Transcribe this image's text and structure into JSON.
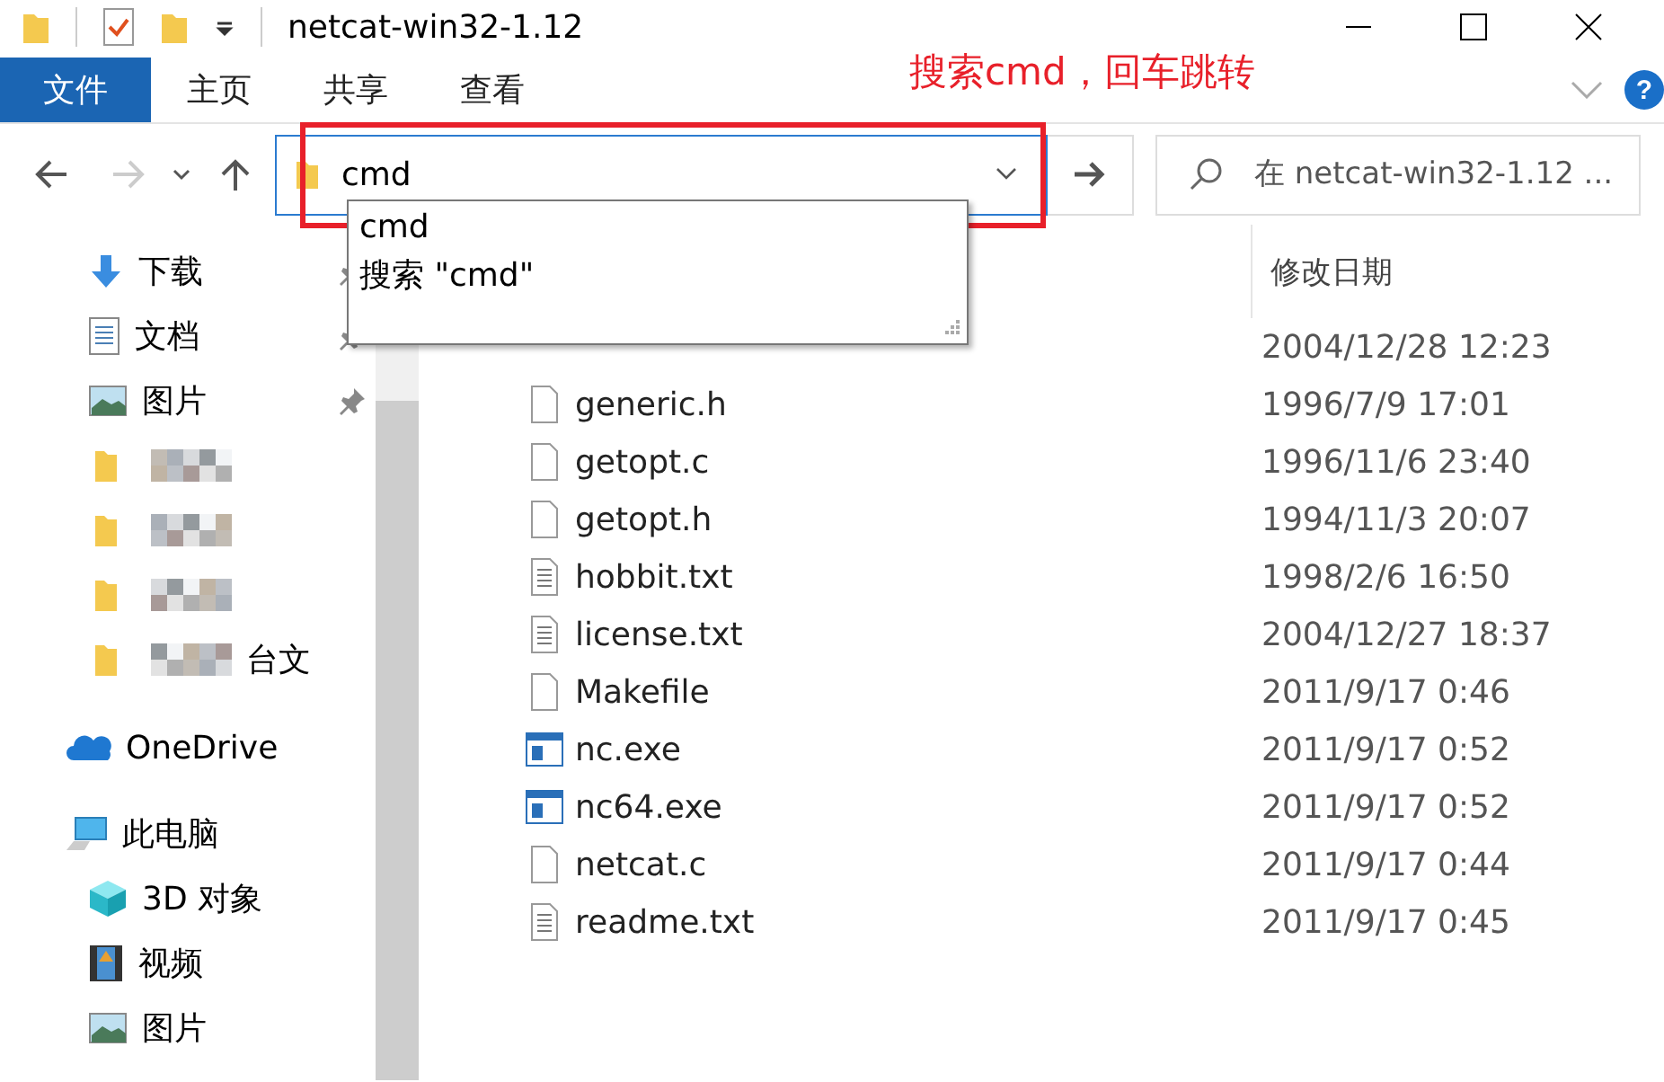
{
  "window": {
    "title": "netcat-win32-1.12"
  },
  "ribbon": {
    "tabs": [
      {
        "label": "文件",
        "selected": true
      },
      {
        "label": "主页",
        "selected": false
      },
      {
        "label": "共享",
        "selected": false
      },
      {
        "label": "查看",
        "selected": false
      }
    ],
    "help": "?"
  },
  "address": {
    "value": "cmd"
  },
  "search": {
    "placeholder": "在 netcat-win32-1.12 ..."
  },
  "autocomplete": {
    "items": [
      "cmd",
      "搜索 \"cmd\""
    ]
  },
  "annotation": {
    "text": "搜索cmd，回车跳转"
  },
  "sidebar": {
    "items": [
      {
        "kind": "download",
        "label": "下载",
        "pinned": true,
        "redacted": false
      },
      {
        "kind": "document",
        "label": "文档",
        "pinned": true,
        "redacted": false
      },
      {
        "kind": "picture",
        "label": "图片",
        "pinned": true,
        "redacted": false
      },
      {
        "kind": "folder",
        "pinned": false,
        "redacted": true
      },
      {
        "kind": "folder",
        "pinned": false,
        "redacted": true
      },
      {
        "kind": "folder",
        "pinned": false,
        "redacted": true
      },
      {
        "kind": "folder",
        "label": "台文",
        "pinned": false,
        "redacted": true
      },
      {
        "kind": "cloud",
        "label": "OneDrive",
        "pinned": false,
        "redacted": false
      },
      {
        "kind": "computer",
        "label": "此电脑",
        "pinned": false,
        "redacted": false
      },
      {
        "kind": "cube",
        "label": "3D 对象",
        "pinned": false,
        "redacted": false
      },
      {
        "kind": "video",
        "label": "视频",
        "pinned": false,
        "redacted": false
      },
      {
        "kind": "picture",
        "label": "图片",
        "pinned": false,
        "redacted": false
      }
    ]
  },
  "file_list": {
    "columns": [
      "修改日期"
    ],
    "rows": [
      {
        "date": "2004/12/28 12:23"
      },
      {
        "kind": "file",
        "name": "generic.h",
        "date": "1996/7/9 17:01"
      },
      {
        "kind": "file",
        "name": "getopt.c",
        "date": "1996/11/6 23:40"
      },
      {
        "kind": "file",
        "name": "getopt.h",
        "date": "1994/11/3 20:07"
      },
      {
        "kind": "text",
        "name": "hobbit.txt",
        "date": "1998/2/6 16:50"
      },
      {
        "kind": "text",
        "name": "license.txt",
        "date": "2004/12/27 18:37"
      },
      {
        "kind": "file",
        "name": "Makefile",
        "date": "2011/9/17 0:46"
      },
      {
        "kind": "exe",
        "name": "nc.exe",
        "date": "2011/9/17 0:52"
      },
      {
        "kind": "exe",
        "name": "nc64.exe",
        "date": "2011/9/17 0:52"
      },
      {
        "kind": "file",
        "name": "netcat.c",
        "date": "2011/9/17 0:44"
      },
      {
        "kind": "text",
        "name": "readme.txt",
        "date": "2011/9/17 0:45"
      }
    ]
  }
}
